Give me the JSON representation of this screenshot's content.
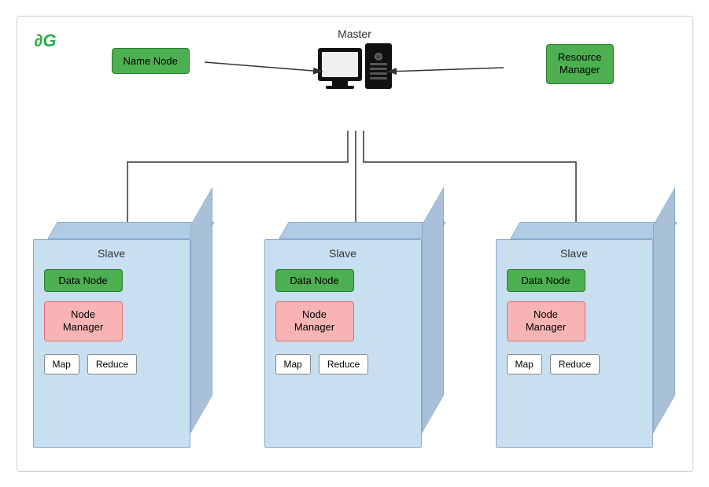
{
  "logo": {
    "text": "∂G"
  },
  "master": {
    "label": "Master"
  },
  "name_node": {
    "label": "Name Node"
  },
  "resource_manager": {
    "line1": "Resource",
    "line2": "Manager"
  },
  "slaves": [
    {
      "label": "Slave",
      "data_node": "Data Node",
      "node_manager_line1": "Node",
      "node_manager_line2": "Manager",
      "map": "Map",
      "reduce": "Reduce"
    },
    {
      "label": "Slave",
      "data_node": "Data Node",
      "node_manager_line1": "Node",
      "node_manager_line2": "Manager",
      "map": "Map",
      "reduce": "Reduce"
    },
    {
      "label": "Slave",
      "data_node": "Data Node",
      "node_manager_line1": "Node",
      "node_manager_line2": "Manager",
      "map": "Map",
      "reduce": "Reduce"
    }
  ],
  "colors": {
    "green_box_bg": "#4caf50",
    "green_box_border": "#2e7d32",
    "red_box_bg": "#f8b4b4",
    "red_box_border": "#e07070",
    "cube_front": "#c8dff0",
    "cube_border": "#88aacc"
  }
}
